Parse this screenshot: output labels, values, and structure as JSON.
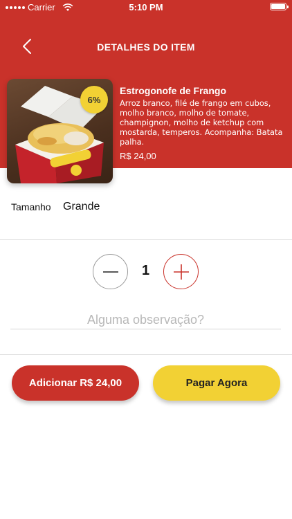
{
  "status_bar": {
    "carrier": "Carrier",
    "time": "5:10 PM"
  },
  "header": {
    "title": "DETALHES DO ITEM",
    "back_icon": "chevron-left-icon"
  },
  "product": {
    "name": "Estrogonofe de Frango",
    "description": "Arroz branco, filé de frango em cubos, molho branco, molho de tomate, champignon, molho de ketchup com mostarda, temperos. Acompanha: Batata palha.",
    "price": "R$ 24,00",
    "discount_badge": "6%"
  },
  "size": {
    "label": "Tamanho",
    "value": "Grande"
  },
  "quantity": {
    "value": "1",
    "minus_icon": "minus-icon",
    "plus_icon": "plus-icon"
  },
  "note": {
    "placeholder": "Alguma observação?",
    "value": ""
  },
  "actions": {
    "add_label": "Adicionar R$ 24,00",
    "pay_label": "Pagar Agora"
  },
  "colors": {
    "primary_red": "#c9322a",
    "accent_yellow": "#f2d134",
    "divider": "#dcdcdc",
    "placeholder": "#b8b8b8"
  }
}
